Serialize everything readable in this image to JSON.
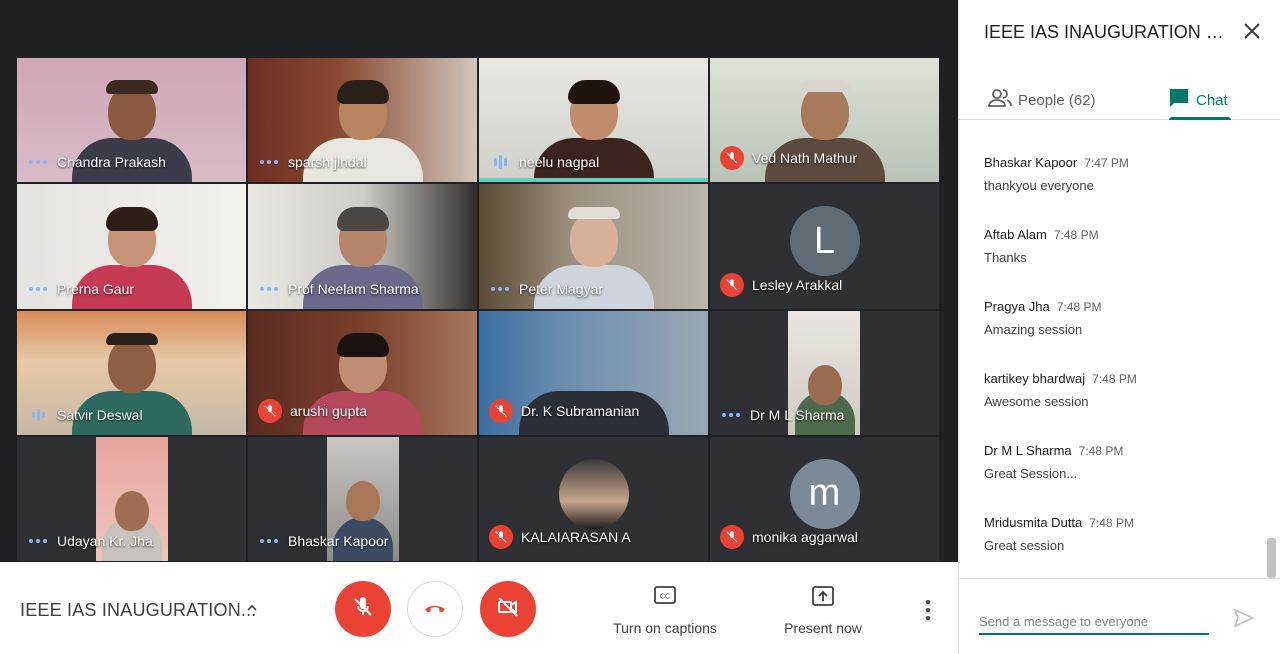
{
  "meeting": {
    "title": "IEEE IAS INAUGURATION..."
  },
  "controls": {
    "captions_label": "Turn on captions",
    "present_label": "Present now"
  },
  "panel": {
    "title": "IEEE IAS INAUGURATION CE...",
    "tabs": {
      "people_label": "People (62)",
      "chat_label": "Chat"
    },
    "input_placeholder": "Send a message to everyone"
  },
  "participants": [
    {
      "name": "Chandra Prakash",
      "status": "dots"
    },
    {
      "name": "sparsh jindal",
      "status": "dots"
    },
    {
      "name": "neelu nagpal",
      "status": "speaking"
    },
    {
      "name": "Ved Nath Mathur",
      "status": "muted"
    },
    {
      "name": "Prerna Gaur",
      "status": "dots"
    },
    {
      "name": "Prof Neelam Sharma",
      "status": "dots"
    },
    {
      "name": "Peter Magyar",
      "status": "dots"
    },
    {
      "name": "Lesley Arakkal",
      "status": "muted",
      "avatar_letter": "L"
    },
    {
      "name": "Satvir Deswal",
      "status": "speaking"
    },
    {
      "name": "arushi gupta",
      "status": "muted"
    },
    {
      "name": "Dr. K Subramanian",
      "status": "muted"
    },
    {
      "name": "Dr M L Sharma",
      "status": "dots"
    },
    {
      "name": "Udayan Kr. Jha",
      "status": "dots"
    },
    {
      "name": "Bhaskar Kapoor",
      "status": "dots"
    },
    {
      "name": "KALAIARASAN A",
      "status": "muted"
    },
    {
      "name": "monika aggarwal",
      "status": "muted",
      "avatar_letter": "m"
    }
  ],
  "messages": [
    {
      "sender": "Bhaskar Kapoor",
      "time": "7:47 PM",
      "text": "thankyou everyone"
    },
    {
      "sender": "Aftab Alam",
      "time": "7:48 PM",
      "text": "Thanks"
    },
    {
      "sender": "Pragya Jha",
      "time": "7:48 PM",
      "text": "Amazing session"
    },
    {
      "sender": "kartikey bhardwaj",
      "time": "7:48 PM",
      "text": "Awesome session"
    },
    {
      "sender": "Dr M L Sharma",
      "time": "7:48 PM",
      "text": "Great Session..."
    },
    {
      "sender": "Mridusmita Dutta",
      "time": "7:48 PM",
      "text": "Great session"
    }
  ],
  "colors": {
    "accent": "#00796b",
    "danger": "#ea4335",
    "speaking": "#5fd3bc"
  }
}
